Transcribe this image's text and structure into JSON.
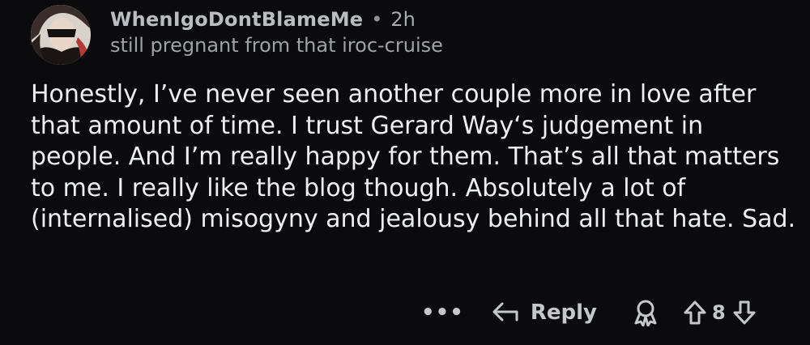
{
  "comment": {
    "username": "WhenIgoDontBlameMe",
    "separator": "•",
    "time": "2h",
    "flair": "still pregnant from that iroc-cruise",
    "body": "Honestly, I’ve never seen another couple more in love after that amount of time. I trust Gerard Way‘s judgement in people. And I’m really happy for them. That’s all that matters to me. I really like the blog though. Absolutely a lot of (internalised) misogyny and jealousy behind all that hate. Sad."
  },
  "actions": {
    "more_label": "•••",
    "reply_label": "Reply",
    "vote_count": "8",
    "icons": [
      "more-options-icon",
      "reply-arrow-icon",
      "award-icon",
      "upvote-icon",
      "downvote-icon"
    ]
  },
  "colors": {
    "background": "#0b0b0d",
    "text": "#eceef0",
    "muted": "#9ea2a7",
    "avatar_ring": "#d2473f"
  }
}
